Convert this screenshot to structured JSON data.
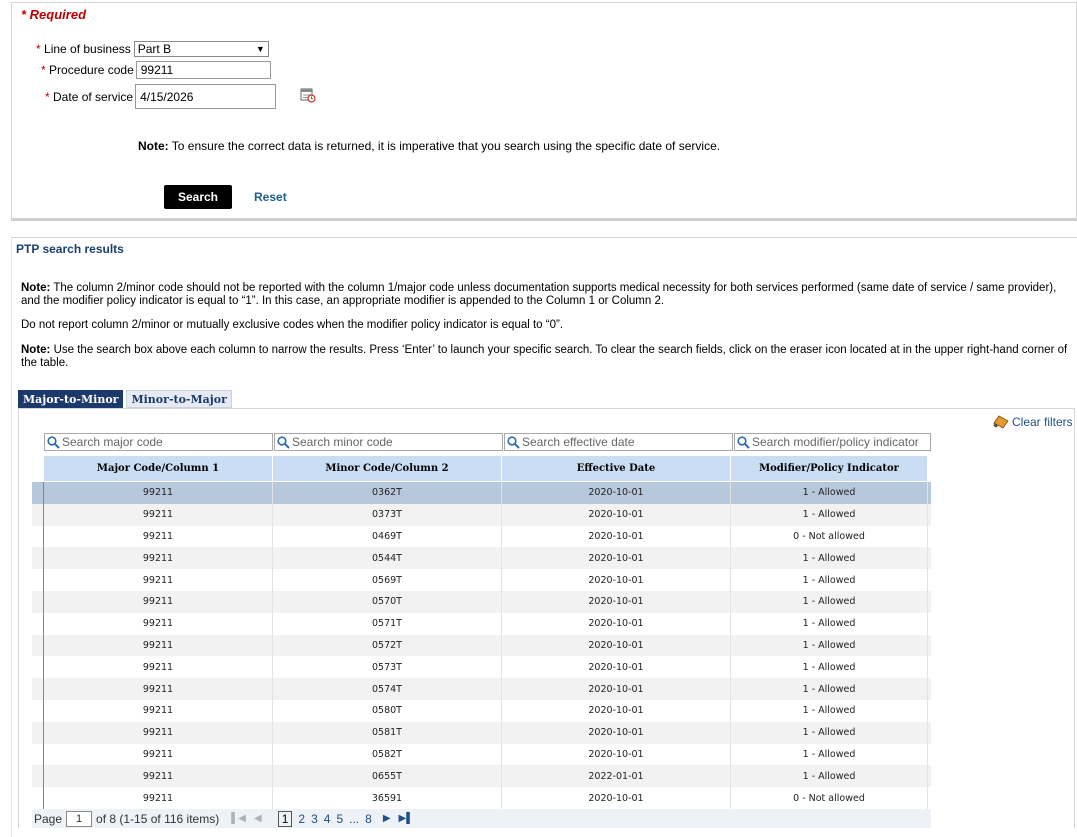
{
  "form": {
    "required_label": "* Required",
    "line_of_business_label": "Line of business",
    "line_of_business_value": "Part B",
    "procedure_code_label": "Procedure code",
    "procedure_code_value": "99211",
    "date_of_service_label": "Date of service",
    "date_of_service_value": "4/15/2026",
    "note_bold": "Note:",
    "note_text": "To ensure the correct data is returned, it is imperative that you search using the specific date of service.",
    "search_label": "Search",
    "reset_label": "Reset"
  },
  "results": {
    "title": "PTP search results",
    "note1_bold": "Note:",
    "note1_text": "The column 2/minor code should not be reported with the column 1/major code unless documentation supports medical necessity for both services performed (same date of service / same provider), and the modifier policy indicator is equal to “1”. In this case, an appropriate modifier is appended to the Column 1 or Column 2.",
    "note2_text": "Do not report column 2/minor or mutually exclusive codes when the modifier policy indicator is equal to “0”.",
    "note3_bold": "Note:",
    "note3_text": "Use the search box above each column to narrow the results. Press ‘Enter’ to launch your specific search. To clear the search fields, click on the eraser icon located at in the upper right-hand corner of the table."
  },
  "tabs": [
    {
      "label": "Major-to-Minor",
      "active": true
    },
    {
      "label": "Minor-to-Major",
      "active": false
    }
  ],
  "grid": {
    "clear_filters_label": "Clear filters",
    "filters": [
      "Search major code",
      "Search minor code",
      "Search effective date",
      "Search modifier/policy indicator"
    ],
    "columns": [
      "Major Code/Column 1",
      "Minor Code/Column 2",
      "Effective Date",
      "Modifier/Policy Indicator"
    ],
    "rows": [
      [
        "99211",
        "0362T",
        "2020-10-01",
        "1 - Allowed"
      ],
      [
        "99211",
        "0373T",
        "2020-10-01",
        "1 - Allowed"
      ],
      [
        "99211",
        "0469T",
        "2020-10-01",
        "0 - Not allowed"
      ],
      [
        "99211",
        "0544T",
        "2020-10-01",
        "1 - Allowed"
      ],
      [
        "99211",
        "0569T",
        "2020-10-01",
        "1 - Allowed"
      ],
      [
        "99211",
        "0570T",
        "2020-10-01",
        "1 - Allowed"
      ],
      [
        "99211",
        "0571T",
        "2020-10-01",
        "1 - Allowed"
      ],
      [
        "99211",
        "0572T",
        "2020-10-01",
        "1 - Allowed"
      ],
      [
        "99211",
        "0573T",
        "2020-10-01",
        "1 - Allowed"
      ],
      [
        "99211",
        "0574T",
        "2020-10-01",
        "1 - Allowed"
      ],
      [
        "99211",
        "0580T",
        "2020-10-01",
        "1 - Allowed"
      ],
      [
        "99211",
        "0581T",
        "2020-10-01",
        "1 - Allowed"
      ],
      [
        "99211",
        "0582T",
        "2020-10-01",
        "1 - Allowed"
      ],
      [
        "99211",
        "0655T",
        "2022-01-01",
        "1 - Allowed"
      ],
      [
        "99211",
        "36591",
        "2020-10-01",
        "0 - Not allowed"
      ]
    ]
  },
  "pager": {
    "page_label": "Page",
    "page_value": "1",
    "of_text": "of 8 (1-15 of 116 items)",
    "pages": [
      "1",
      "2",
      "3",
      "4",
      "5",
      "...",
      "8"
    ]
  },
  "icons": {
    "calendar": "calendar-icon",
    "search": "search-icon",
    "eraser": "eraser-icon"
  },
  "colors": {
    "required_red": "#c00000",
    "header_blue": "#c9ddf3",
    "tab_active": "#1b3a6b",
    "link_blue": "#1f4f8c"
  }
}
